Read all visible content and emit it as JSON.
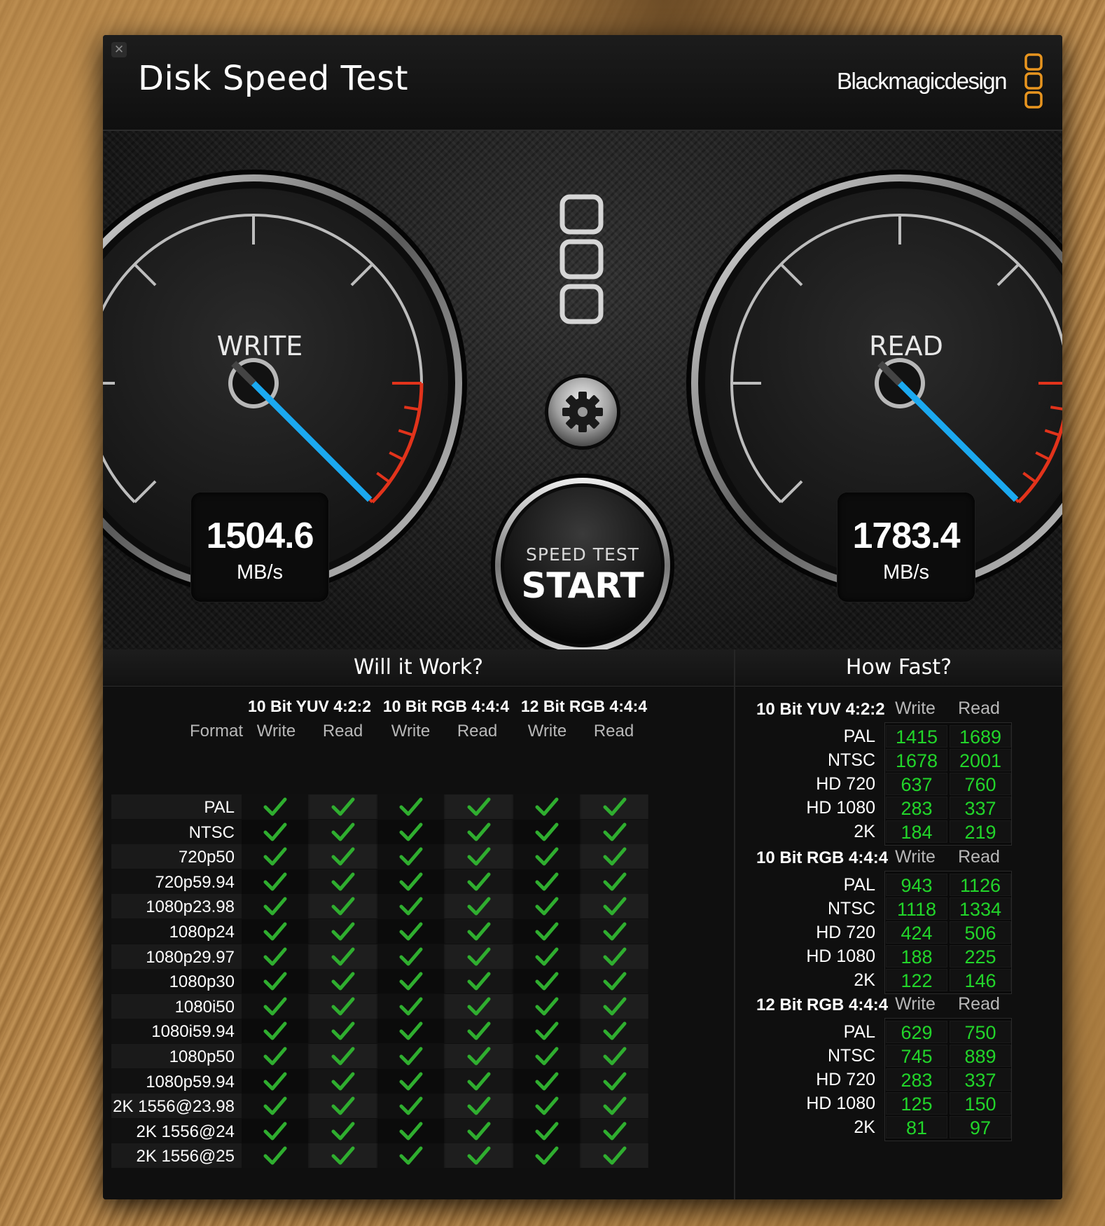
{
  "window": {
    "close_icon": "close-icon",
    "title": "Disk Speed Test",
    "brand": "Blackmagicdesign",
    "brand_logo": "blackmagic-logo-icon",
    "brand_color": "#e8951f"
  },
  "gauges": {
    "write": {
      "label": "WRITE",
      "value": "1504.6",
      "unit": "MB/s",
      "needle_color": "#1ba9f0"
    },
    "read": {
      "label": "READ",
      "value": "1783.4",
      "unit": "MB/s",
      "needle_color": "#1ba9f0"
    }
  },
  "controls": {
    "settings_icon": "gear-icon",
    "start_top": "SPEED TEST",
    "start_main": "START"
  },
  "will_it_work": {
    "title": "Will it Work?",
    "format_label": "Format",
    "groups": [
      "10 Bit YUV 4:2:2",
      "10 Bit RGB 4:4:4",
      "12 Bit RGB 4:4:4"
    ],
    "subcols": [
      "Write",
      "Read",
      "Write",
      "Read",
      "Write",
      "Read"
    ],
    "rows": [
      {
        "format": "PAL",
        "checks": [
          true,
          true,
          true,
          true,
          true,
          true
        ]
      },
      {
        "format": "NTSC",
        "checks": [
          true,
          true,
          true,
          true,
          true,
          true
        ]
      },
      {
        "format": "720p50",
        "checks": [
          true,
          true,
          true,
          true,
          true,
          true
        ]
      },
      {
        "format": "720p59.94",
        "checks": [
          true,
          true,
          true,
          true,
          true,
          true
        ]
      },
      {
        "format": "1080p23.98",
        "checks": [
          true,
          true,
          true,
          true,
          true,
          true
        ]
      },
      {
        "format": "1080p24",
        "checks": [
          true,
          true,
          true,
          true,
          true,
          true
        ]
      },
      {
        "format": "1080p29.97",
        "checks": [
          true,
          true,
          true,
          true,
          true,
          true
        ]
      },
      {
        "format": "1080p30",
        "checks": [
          true,
          true,
          true,
          true,
          true,
          true
        ]
      },
      {
        "format": "1080i50",
        "checks": [
          true,
          true,
          true,
          true,
          true,
          true
        ]
      },
      {
        "format": "1080i59.94",
        "checks": [
          true,
          true,
          true,
          true,
          true,
          true
        ]
      },
      {
        "format": "1080p50",
        "checks": [
          true,
          true,
          true,
          true,
          true,
          true
        ]
      },
      {
        "format": "1080p59.94",
        "checks": [
          true,
          true,
          true,
          true,
          true,
          true
        ]
      },
      {
        "format": "2K 1556@23.98",
        "checks": [
          true,
          true,
          true,
          true,
          true,
          true
        ]
      },
      {
        "format": "2K 1556@24",
        "checks": [
          true,
          true,
          true,
          true,
          true,
          true
        ]
      },
      {
        "format": "2K 1556@25",
        "checks": [
          true,
          true,
          true,
          true,
          true,
          true
        ]
      }
    ],
    "check_icon": "checkmark-icon",
    "check_color": "#2fae2f"
  },
  "how_fast": {
    "title": "How Fast?",
    "value_color": "#22d52a",
    "sections": [
      {
        "name": "10 Bit YUV 4:2:2",
        "write_label": "Write",
        "read_label": "Read",
        "rows": [
          {
            "format": "PAL",
            "write": "1415",
            "read": "1689"
          },
          {
            "format": "NTSC",
            "write": "1678",
            "read": "2001"
          },
          {
            "format": "HD 720",
            "write": "637",
            "read": "760"
          },
          {
            "format": "HD 1080",
            "write": "283",
            "read": "337"
          },
          {
            "format": "2K",
            "write": "184",
            "read": "219"
          }
        ]
      },
      {
        "name": "10 Bit RGB 4:4:4",
        "write_label": "Write",
        "read_label": "Read",
        "rows": [
          {
            "format": "PAL",
            "write": "943",
            "read": "1126"
          },
          {
            "format": "NTSC",
            "write": "1118",
            "read": "1334"
          },
          {
            "format": "HD 720",
            "write": "424",
            "read": "506"
          },
          {
            "format": "HD 1080",
            "write": "188",
            "read": "225"
          },
          {
            "format": "2K",
            "write": "122",
            "read": "146"
          }
        ]
      },
      {
        "name": "12 Bit RGB 4:4:4",
        "write_label": "Write",
        "read_label": "Read",
        "rows": [
          {
            "format": "PAL",
            "write": "629",
            "read": "750"
          },
          {
            "format": "NTSC",
            "write": "745",
            "read": "889"
          },
          {
            "format": "HD 720",
            "write": "283",
            "read": "337"
          },
          {
            "format": "HD 1080",
            "write": "125",
            "read": "150"
          },
          {
            "format": "2K",
            "write": "81",
            "read": "97"
          }
        ]
      }
    ]
  }
}
